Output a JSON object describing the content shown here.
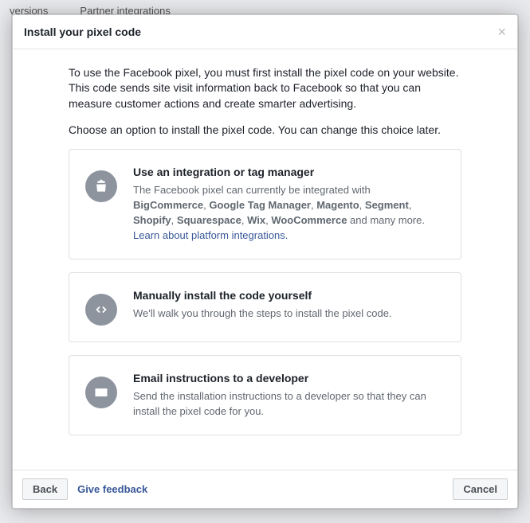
{
  "background": {
    "tab1": "versions",
    "tab2": "Partner integrations"
  },
  "modal": {
    "title": "Install your pixel code",
    "intro1": "To use the Facebook pixel, you must first install the pixel code on your website. This code sends site visit information back to Facebook so that you can measure customer actions and create smarter advertising.",
    "intro2": "Choose an option to install the pixel code. You can change this choice later."
  },
  "options": {
    "integration": {
      "title": "Use an integration or tag manager",
      "desc_prefix": "The Facebook pixel can currently be integrated with ",
      "platforms": [
        "BigCommerce",
        "Google Tag Manager",
        "Magento",
        "Segment",
        "Shopify",
        "Squarespace",
        "Wix",
        "WooCommerce"
      ],
      "desc_suffix": " and many more.",
      "link": "Learn about platform integrations"
    },
    "manual": {
      "title": "Manually install the code yourself",
      "desc": "We'll walk you through the steps to install the pixel code."
    },
    "email": {
      "title": "Email instructions to a developer",
      "desc": "Send the installation instructions to a developer so that they can install the pixel code for you."
    }
  },
  "footer": {
    "back": "Back",
    "feedback": "Give feedback",
    "cancel": "Cancel"
  }
}
